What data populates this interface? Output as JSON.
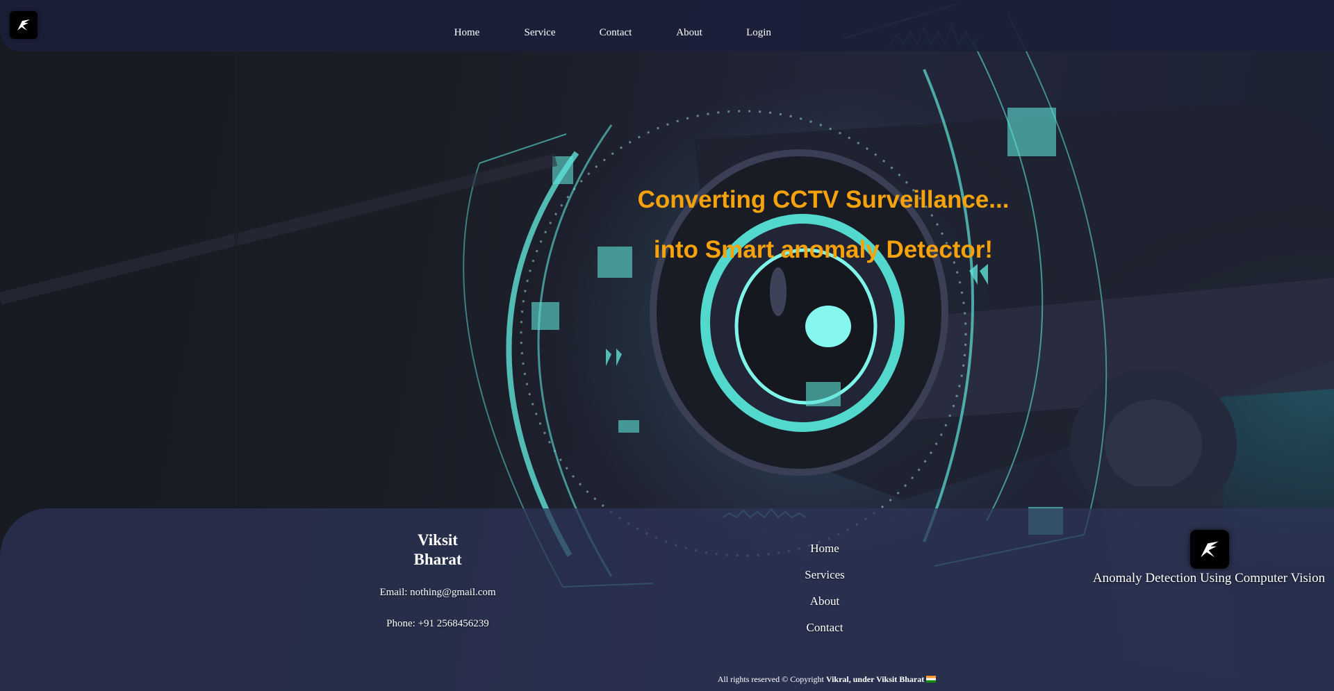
{
  "nav": {
    "logo_icon": "falcon-logo-icon",
    "links": [
      "Home",
      "Service",
      "Contact",
      "About",
      "Login"
    ]
  },
  "hero": {
    "line1": "Converting CCTV Surveillance...",
    "line2": "into Smart anomaly Detector!",
    "background_icon": "cctv-camera-illustration",
    "headline_color": "#f5a20c"
  },
  "footer": {
    "brand_line1": "Viksit",
    "brand_line2": "Bharat",
    "email": "Email: nothing@gmail.com",
    "phone": "Phone: +91 2568456239",
    "links": [
      "Home",
      "Services",
      "About",
      "Contact"
    ],
    "logo_icon": "falcon-logo-icon",
    "tagline": "Anomaly Detection Using Computer Vision",
    "copyright_prefix": "All rights reserved © Copyright",
    "copyright_bold": "Vikral, under Viksit Bharat",
    "flag_icon": "india-flag-icon"
  }
}
